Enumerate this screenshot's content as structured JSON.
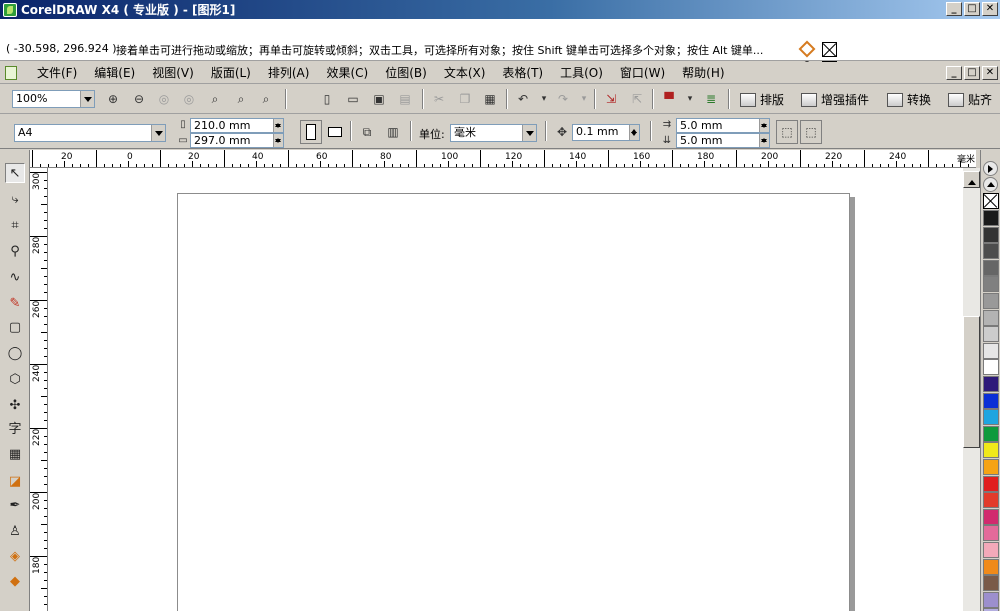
{
  "window": {
    "title": "CorelDRAW X4 ( 专业版 ) - [图形1]",
    "buttons": [
      "_",
      "□",
      "✕"
    ]
  },
  "status": {
    "coords": "( -30.598, 296.924 )",
    "hint": "接着单击可进行拖动或缩放；再单击可旋转或倾斜；双击工具，可选择所有对象；按住 Shift 键单击可选择多个对象；按住 Alt 键单..."
  },
  "menubar": {
    "items": [
      "文件(F)",
      "编辑(E)",
      "视图(V)",
      "版面(L)",
      "排列(A)",
      "效果(C)",
      "位图(B)",
      "文本(X)",
      "表格(T)",
      "工具(O)",
      "窗口(W)",
      "帮助(H)"
    ]
  },
  "toolbar1": {
    "zoom": "100%",
    "arrange_label": "排版",
    "plugin_label": "增强插件",
    "convert_label": "转换",
    "snap_label": "贴齐"
  },
  "toolbar2": {
    "paper": "A4",
    "width": "210.0 mm",
    "height": "297.0 mm",
    "unit_label": "单位:",
    "unit_value": "毫米",
    "nudge": "0.1 mm",
    "dup_x": "5.0 mm",
    "dup_y": "5.0 mm"
  },
  "toolbox": {
    "icons": [
      "pick-tool-icon",
      "shape-tool-icon",
      "crop-tool-icon",
      "zoom-tool-icon",
      "freehand-tool-icon",
      "smart-fill-icon",
      "rectangle-tool-icon",
      "ellipse-tool-icon",
      "polygon-tool-icon",
      "basic-shapes-icon",
      "text-tool-icon",
      "table-tool-icon",
      "interactive-blend-icon",
      "eyedropper-icon",
      "outline-pen-icon",
      "fill-tool-icon",
      "interactive-fill-icon"
    ],
    "text_tool_glyph": "字"
  },
  "ruler": {
    "top_labels": [
      "20",
      "0",
      "20",
      "40",
      "60",
      "80",
      "100",
      "120",
      "140",
      "160",
      "180",
      "200",
      "220",
      "240"
    ],
    "unit": "毫米",
    "left_labels": [
      "300",
      "280",
      "260",
      "240",
      "220",
      "200",
      "180"
    ]
  },
  "palette": {
    "colors": [
      "#1a1a1a",
      "#333333",
      "#4d4d4d",
      "#666666",
      "#808080",
      "#999999",
      "#b3b3b3",
      "#cccccc",
      "#e6e6e6",
      "#ffffff",
      "#2e1a7a",
      "#0b2fd6",
      "#1fa5e0",
      "#0e9a3c",
      "#f0e81a",
      "#f5a314",
      "#e11e1e",
      "#e23b2a",
      "#d12a6e",
      "#e36a9a",
      "#f3a9b9",
      "#f08a1a",
      "#7a5a48",
      "#9c8fcd",
      "#b4aee0",
      "#6a7fc5"
    ]
  }
}
